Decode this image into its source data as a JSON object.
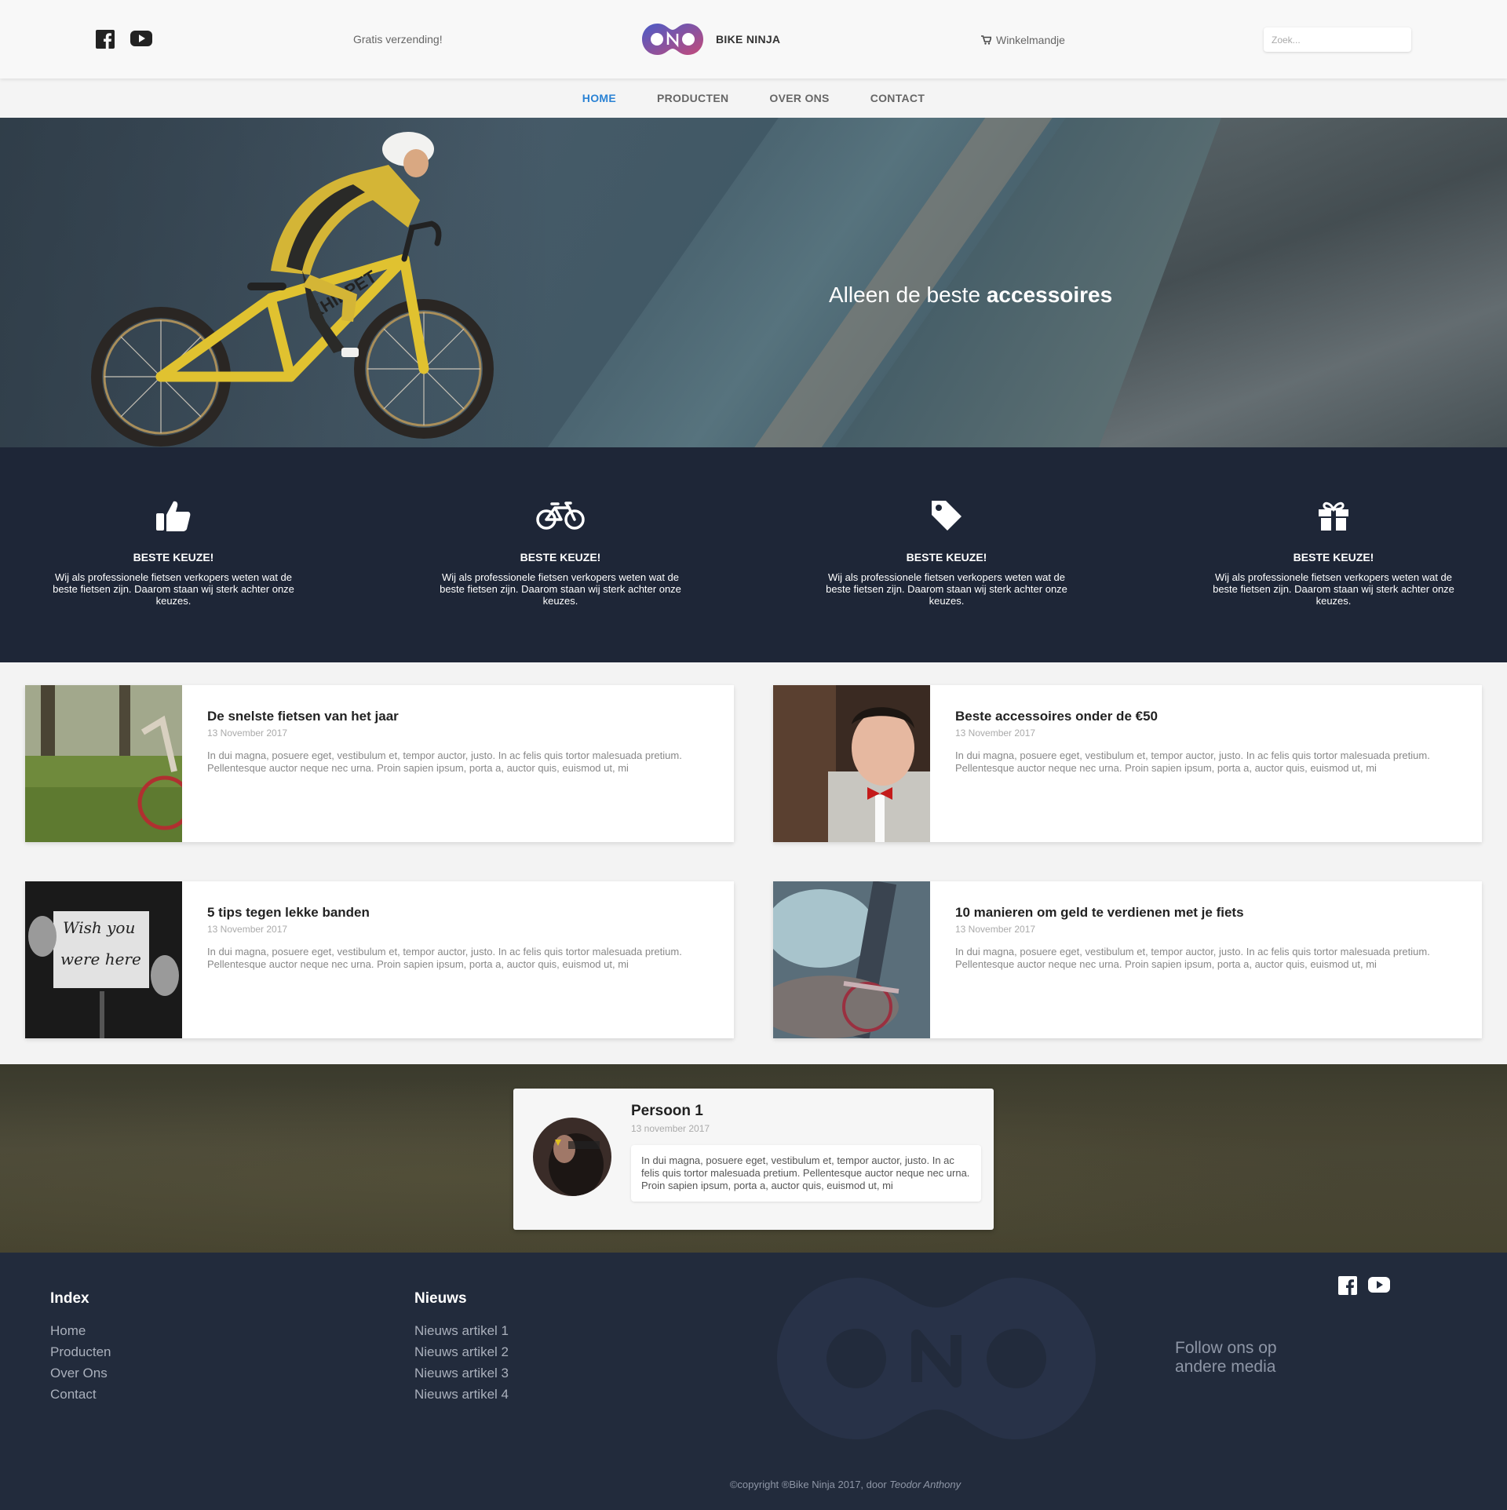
{
  "header": {
    "shipping_text": "Gratis verzending!",
    "brand_name": "BIKE NINJA",
    "cart_label": "Winkelmandje",
    "search_placeholder": "Zoek...",
    "social_icons": [
      "facebook-icon",
      "youtube-icon"
    ]
  },
  "nav": {
    "items": [
      {
        "label": "HOME",
        "active": true
      },
      {
        "label": "PRODUCTEN",
        "active": false
      },
      {
        "label": "OVER ONS",
        "active": false
      },
      {
        "label": "CONTACT",
        "active": false
      }
    ],
    "active_color": "#2a82d4"
  },
  "hero": {
    "text_light": "Alleen de beste",
    "text_bold": "accessoires"
  },
  "features": [
    {
      "icon": "thumbs-up-icon",
      "title": "BESTE KEUZE!",
      "text": "Wij als professionele fietsen verkopers weten wat de beste fietsen zijn. Daarom staan wij sterk achter onze keuzes."
    },
    {
      "icon": "bicycle-icon",
      "title": "BESTE KEUZE!",
      "text": "Wij als professionele fietsen verkopers weten wat de beste fietsen zijn. Daarom staan wij sterk achter onze keuzes."
    },
    {
      "icon": "tag-icon",
      "title": "BESTE KEUZE!",
      "text": "Wij als professionele fietsen verkopers weten wat de beste fietsen zijn. Daarom staan wij sterk achter onze keuzes."
    },
    {
      "icon": "gift-icon",
      "title": "BESTE KEUZE!",
      "text": "Wij als professionele fietsen verkopers weten wat de beste fietsen zijn. Daarom staan wij sterk achter onze keuzes."
    }
  ],
  "articles": [
    {
      "title": "De snelste fietsen van het jaar",
      "date": "13 November 2017",
      "text": "In dui magna, posuere eget, vestibulum et, tempor auctor, justo. In ac felis quis tortor malesuada pretium. Pellentesque auctor neque nec urna. Proin sapien ipsum, porta a, auctor quis, euismod ut, mi"
    },
    {
      "title": "Beste accessoires onder de €50",
      "date": "13 November 2017",
      "text": "In dui magna, posuere eget, vestibulum et, tempor auctor, justo. In ac felis quis tortor malesuada pretium. Pellentesque auctor neque nec urna. Proin sapien ipsum, porta a, auctor quis, euismod ut, mi"
    },
    {
      "title": "5 tips tegen lekke banden",
      "date": "13 November 2017",
      "text": "In dui magna, posuere eget, vestibulum et, tempor auctor, justo. In ac felis quis tortor malesuada pretium. Pellentesque auctor neque nec urna. Proin sapien ipsum, porta a, auctor quis, euismod ut, mi",
      "thumb_text": [
        "Wish you",
        "were here"
      ]
    },
    {
      "title": "10 manieren om geld te verdienen met je fiets",
      "date": "13 November 2017",
      "text": "In dui magna, posuere eget, vestibulum et, tempor auctor, justo. In ac felis quis tortor malesuada pretium. Pellentesque auctor neque nec urna. Proin sapien ipsum, porta a, auctor quis, euismod ut, mi"
    }
  ],
  "testimonial": {
    "name": "Persoon 1",
    "date": "13 november 2017",
    "text": "In dui magna, posuere eget, vestibulum et, tempor auctor, justo. In ac felis quis tortor malesuada pretium. Pellentesque auctor neque nec urna. Proin sapien ipsum, porta a, auctor quis, euismod ut, mi"
  },
  "footer": {
    "col1_title": "Index",
    "col1_links": [
      "Home",
      "Producten",
      "Over Ons",
      "Contact"
    ],
    "col2_title": "Nieuws",
    "col2_links": [
      "Nieuws artikel 1",
      "Nieuws artikel 2",
      "Nieuws artikel 3",
      "Nieuws artikel 4"
    ],
    "follow_text": "Follow ons op andere media",
    "copyright_prefix": "©copyright ®Bike Ninja 2017, door",
    "copyright_author": "Teodor Anthony"
  },
  "colors": {
    "dark_navy": "#1e2637",
    "footer_bg": "#222b3c",
    "logo_gradient_start": "#4a5cc8",
    "logo_gradient_end": "#c34a7a"
  }
}
